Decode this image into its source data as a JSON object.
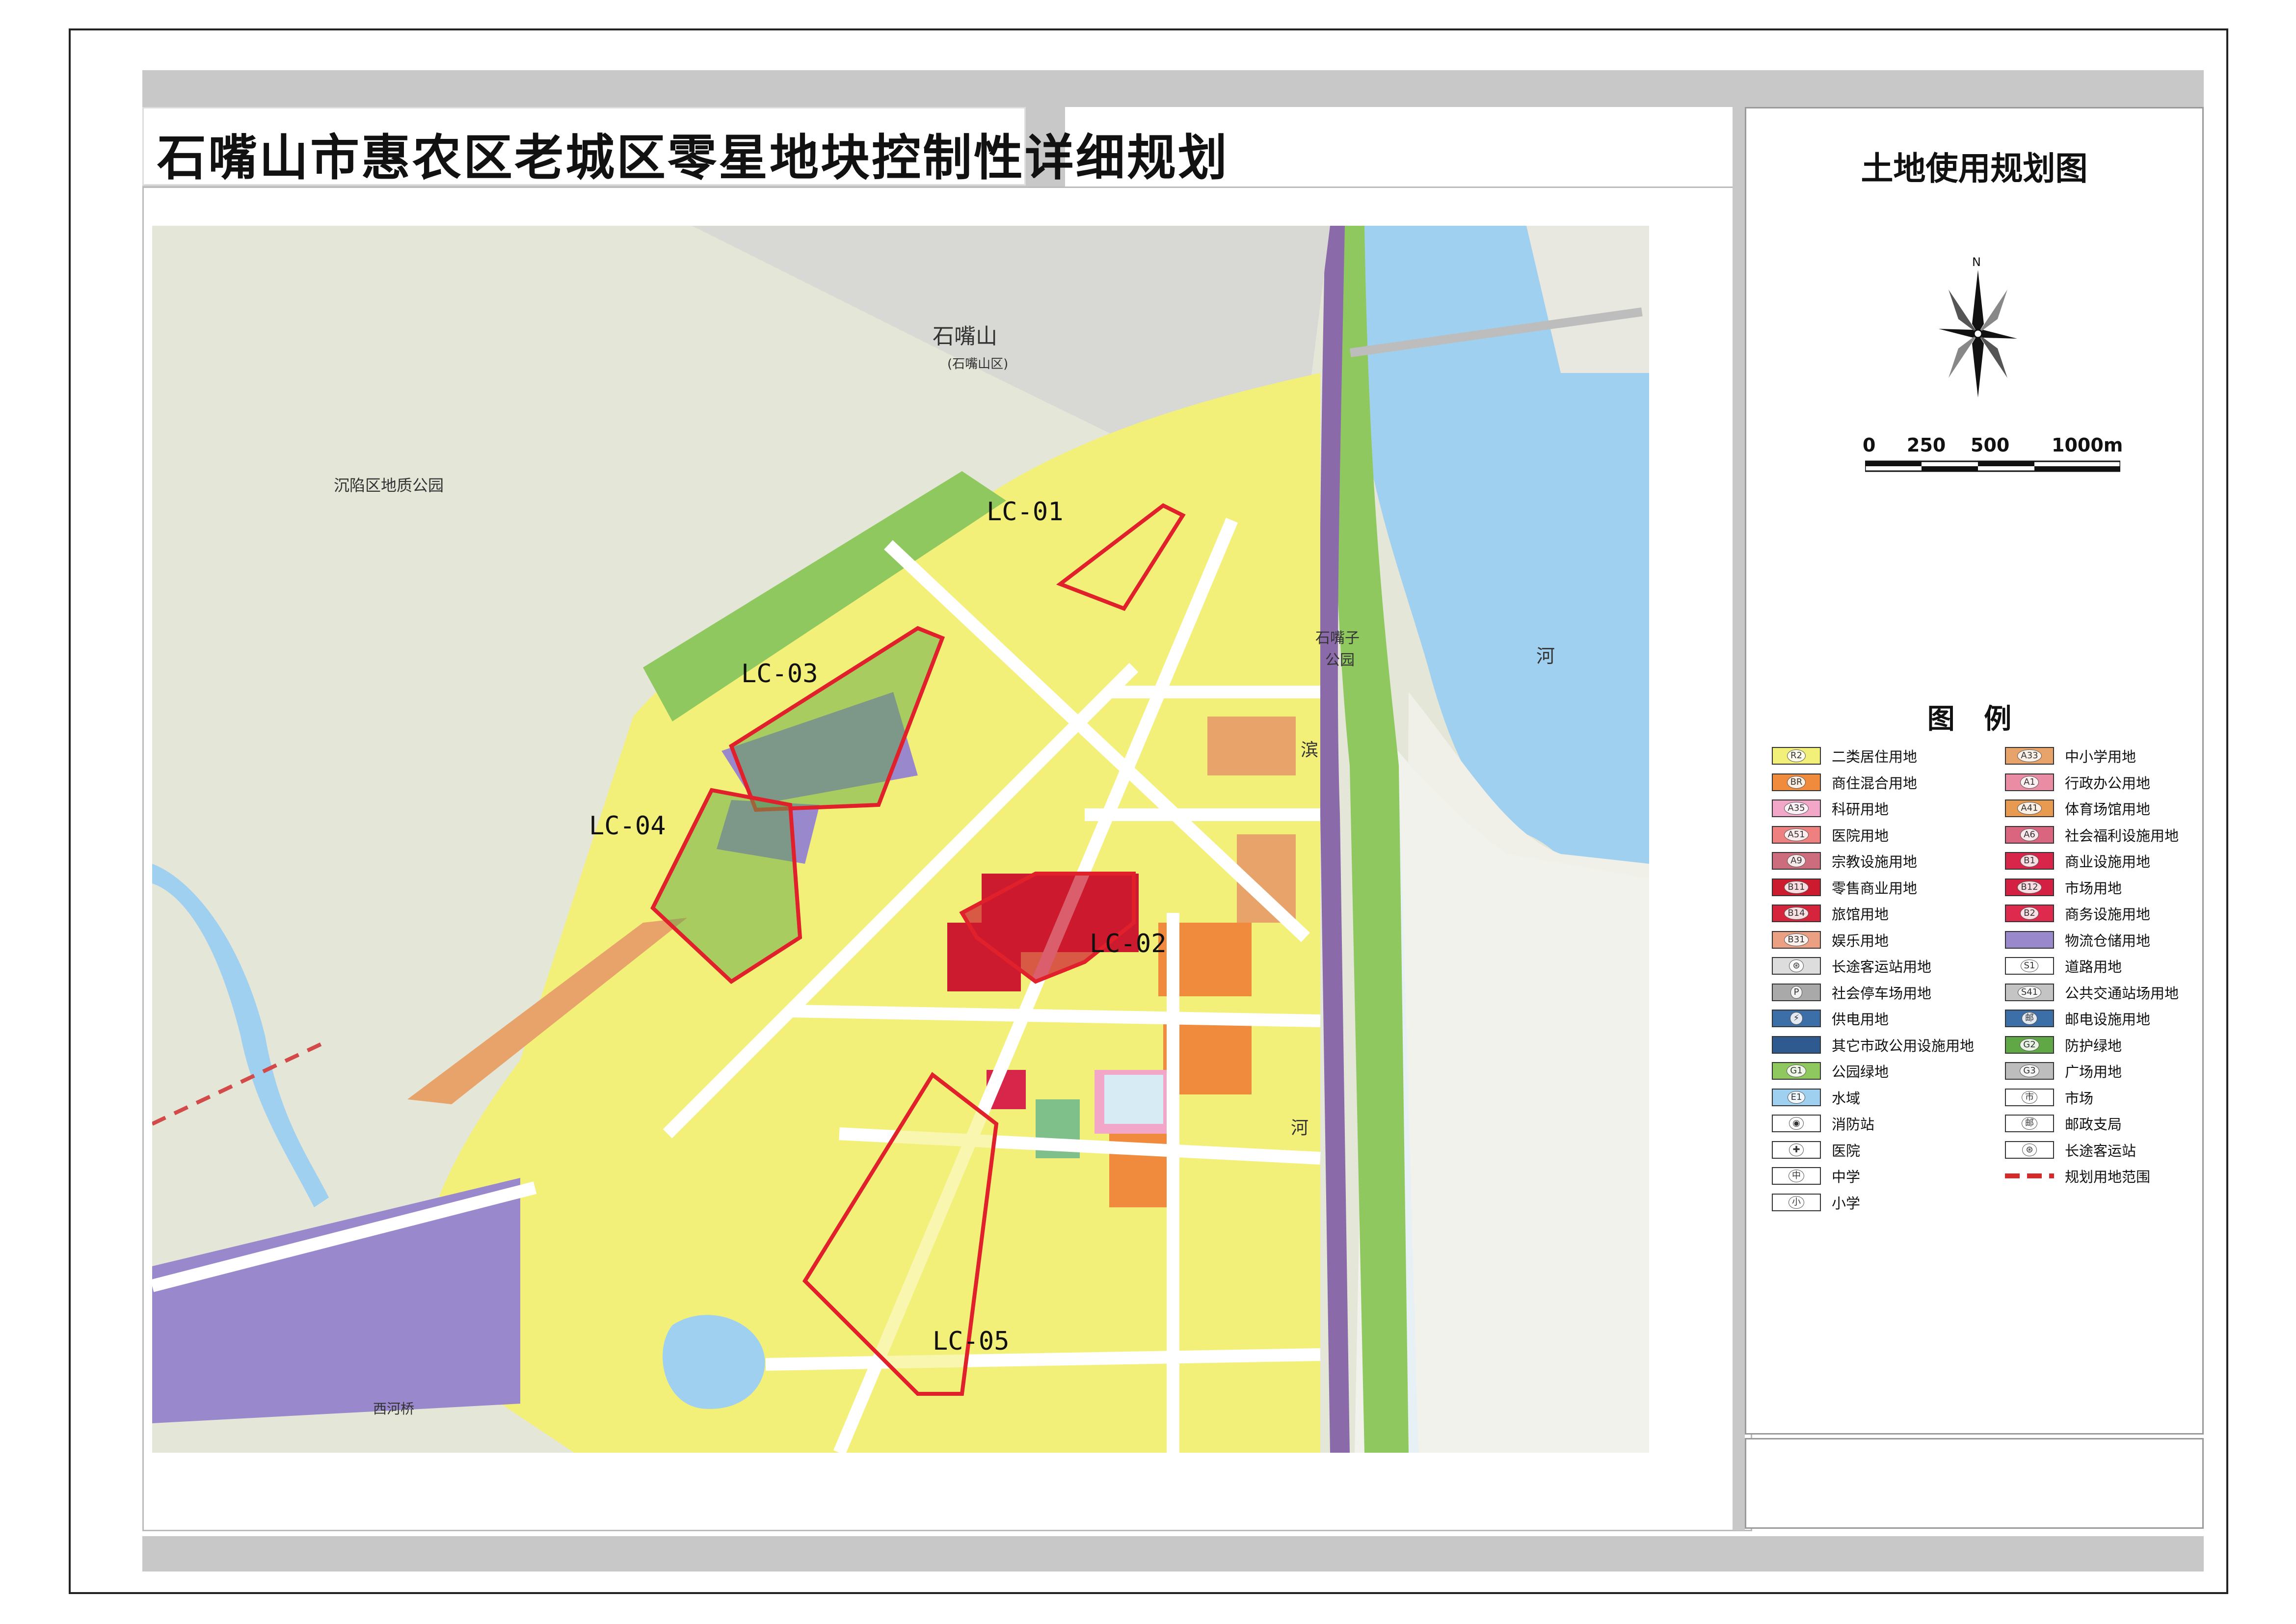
{
  "title": "石嘴山市惠农区老城区零星地块控制性详细规划",
  "sheet_title": "土地使用规划图",
  "north": "N",
  "scale": [
    "0",
    "250",
    "500",
    "1000m"
  ],
  "legend_heading": "图 例",
  "legend": [
    {
      "code": "R2",
      "label": "二类居住用地",
      "color": "#f3f07a"
    },
    {
      "code": "A33",
      "label": "中小学用地",
      "color": "#e8a36b"
    },
    {
      "code": "BR",
      "label": "商住混合用地",
      "color": "#f08a3c"
    },
    {
      "code": "A1",
      "label": "行政办公用地",
      "color": "#e98ca4"
    },
    {
      "code": "A35",
      "label": "科研用地",
      "color": "#f2a6c8"
    },
    {
      "code": "A41",
      "label": "体育场馆用地",
      "color": "#e89a50"
    },
    {
      "code": "A51",
      "label": "医院用地",
      "color": "#ee8080"
    },
    {
      "code": "A6",
      "label": "社会福利设施用地",
      "color": "#d9667e"
    },
    {
      "code": "A9",
      "label": "宗教设施用地",
      "color": "#cd6c7c"
    },
    {
      "code": "B1",
      "label": "商业设施用地",
      "color": "#d8254a"
    },
    {
      "code": "B11",
      "label": "零售商业用地",
      "color": "#cc1a2e"
    },
    {
      "code": "B12",
      "label": "市场用地",
      "color": "#d42042"
    },
    {
      "code": "B14",
      "label": "旅馆用地",
      "color": "#d5243c"
    },
    {
      "code": "B2",
      "label": "商务设施用地",
      "color": "#de2a4c"
    },
    {
      "code": "B31",
      "label": "娱乐用地",
      "color": "#eba084"
    },
    {
      "code": "",
      "label": "物流仓储用地",
      "color": "#9a88cc"
    },
    {
      "code": "⊛",
      "label": "长途客运站用地",
      "color": "#dddddd"
    },
    {
      "code": "S1",
      "label": "道路用地",
      "color": "#ffffff"
    },
    {
      "code": "P",
      "label": "社会停车场用地",
      "color": "#a9a9a9"
    },
    {
      "code": "S41",
      "label": "公共交通站场用地",
      "color": "#c4c4c4"
    },
    {
      "code": "⚡",
      "label": "供电用地",
      "color": "#3c6ea8"
    },
    {
      "code": "邮",
      "label": "邮电设施用地",
      "color": "#3c6ea8"
    },
    {
      "code": "",
      "label": "其它市政公用设施用地",
      "color": "#2f5a8f"
    },
    {
      "code": "G2",
      "label": "防护绿地",
      "color": "#5fa845"
    },
    {
      "code": "G1",
      "label": "公园绿地",
      "color": "#8ec85e"
    },
    {
      "code": "G3",
      "label": "广场用地",
      "color": "#bdbdbd"
    },
    {
      "code": "E1",
      "label": "水域",
      "color": "#9fd0ef"
    },
    {
      "code": "市",
      "label": "市场",
      "color": "#ffffff"
    },
    {
      "code": "◉",
      "label": "消防站",
      "color": "#ffffff"
    },
    {
      "code": "邮",
      "label": "邮政支局",
      "color": "#ffffff"
    },
    {
      "code": "✚",
      "label": "医院",
      "color": "#ffffff"
    },
    {
      "code": "⊛",
      "label": "长途客运站",
      "color": "#ffffff"
    },
    {
      "code": "中",
      "label": "中学",
      "color": "#ffffff"
    },
    {
      "code": "",
      "label": "规划用地范围",
      "color": "#ffffff"
    },
    {
      "code": "小",
      "label": "小学",
      "color": "#ffffff"
    }
  ],
  "map_labels": {
    "lc01": "LC-01",
    "lc02": "LC-02",
    "lc03": "LC-03",
    "lc04": "LC-04",
    "lc05": "LC-05",
    "city": "石嘴山",
    "district": "(石嘴山区)",
    "geopark": "沉陷区地质公园",
    "park1": "石嘴子",
    "park2": "公园",
    "river_he": "河",
    "river_bin": "滨",
    "river_he2": "河",
    "xihe": "西河桥"
  },
  "colors": {
    "residential": "#f3f07a",
    "commercial": "#cc1a2e",
    "mixed": "#f08a3c",
    "school": "#e8a36b",
    "logistics": "#9a88cc",
    "green": "#5fa845",
    "park": "#8ec85e",
    "water": "#9fd0ef",
    "road": "#ffffff",
    "base": "#e4e7d8",
    "boundary": "#e0202a",
    "rail": "#8a6aa8"
  }
}
